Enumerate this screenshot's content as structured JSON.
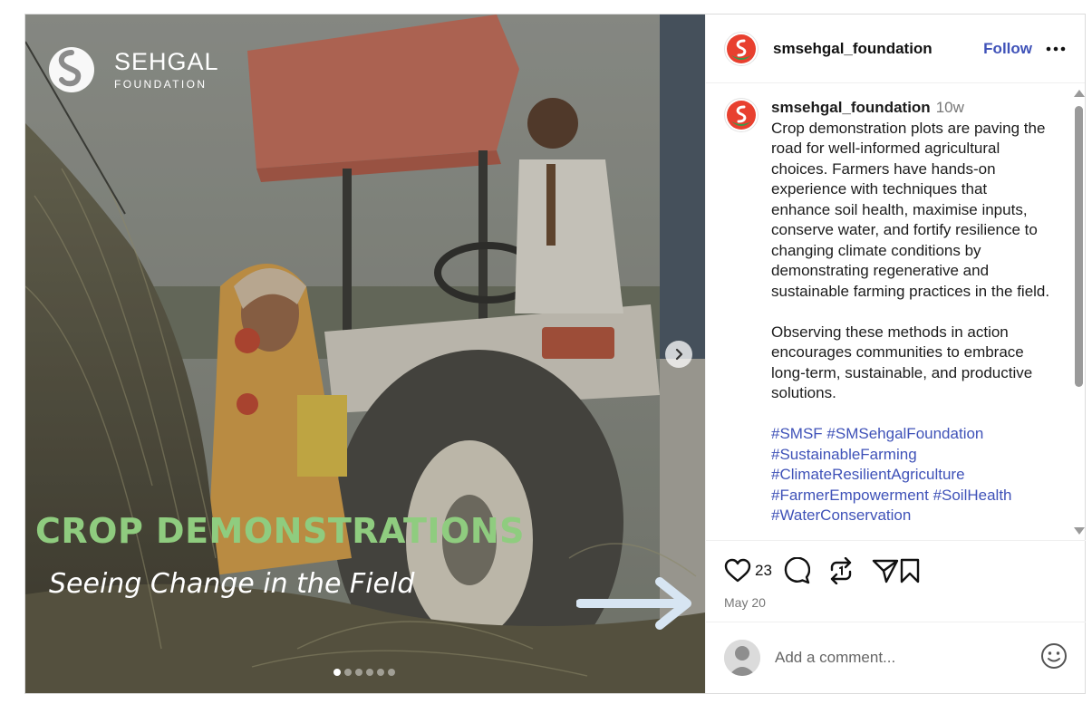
{
  "media": {
    "brand_name": "SEHGAL",
    "brand_sub": "FOUNDATION",
    "headline": "CROP DEMONSTRATIONS",
    "subline": "Seeing Change in the Field",
    "slide_count": 6,
    "active_slide": 1
  },
  "header": {
    "username": "smsehgal_foundation",
    "follow_label": "Follow"
  },
  "post": {
    "username": "smsehgal_foundation",
    "time": "10w",
    "paragraph1": "Crop demonstration plots are paving the road for well-informed agricultural choices. Farmers have hands-on experience with techniques that enhance soil health, maximise inputs, conserve water, and fortify resilience to changing climate conditions by demonstrating regenerative and sustainable farming practices in the field.",
    "paragraph2": "Observing these methods in action encourages communities to embrace long-term, sustainable, and productive solutions.",
    "hashtags": [
      "#SMSF",
      "#SMSehgalFoundation",
      "#SustainableFarming",
      "#ClimateResilientAgriculture",
      "#FarmerEmpowerment",
      "#SoilHealth",
      "#WaterConservation"
    ]
  },
  "actions": {
    "like_count": "23",
    "date": "May 20"
  },
  "comment": {
    "placeholder": "Add a comment..."
  },
  "colors": {
    "link": "#3f52b8",
    "headline_green": "#8fcc7f",
    "logo_red": "#e8402f",
    "logo_green": "#3a9a4a"
  },
  "icons": [
    "heart-icon",
    "comment-icon",
    "repost-icon",
    "share-icon",
    "bookmark-icon",
    "more-icon",
    "chevron-right-icon",
    "emoji-icon"
  ]
}
